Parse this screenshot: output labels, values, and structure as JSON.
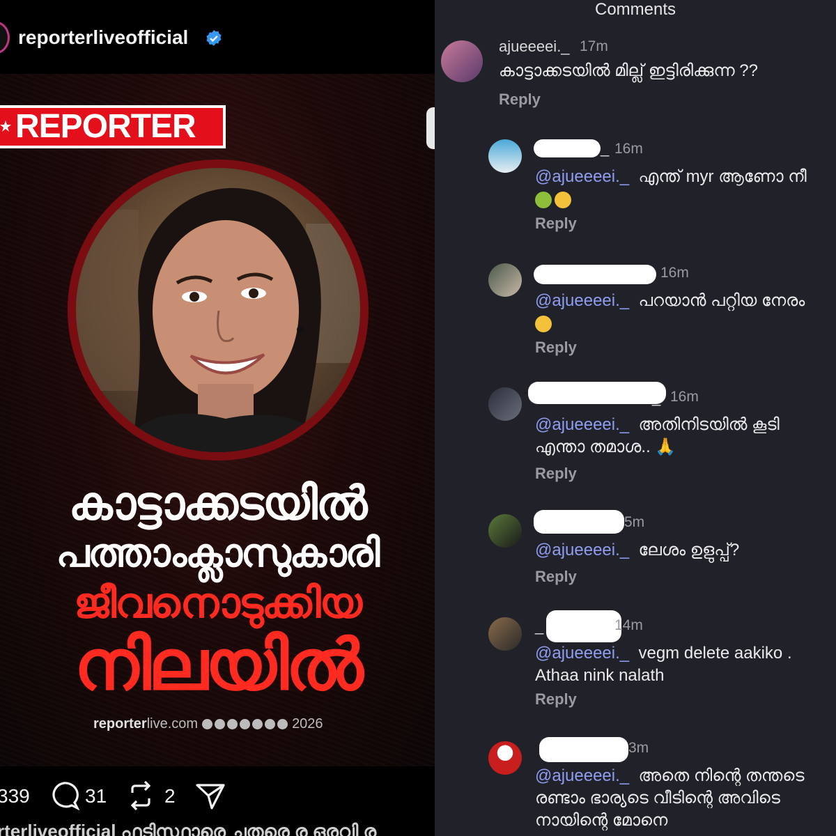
{
  "post": {
    "username": "reporterliveofficial",
    "verified": true,
    "logo_text": "REPORTER",
    "headline": [
      "കാട്ടാക്കടയിൽ",
      "പത്താംക്ലാസുകാരി",
      "ജീവനൊടുക്കിയ",
      "നിലയിൽ"
    ],
    "footer_site_bold": "reporter",
    "footer_site_rest": "live.com",
    "footer_year": "2026",
    "likes": "339",
    "comments_count": "31",
    "reposts": "2",
    "caption_partial": "rterliveofficial  ഫടിസ്ഥാരെ ചതരെ ര  ഒരവി ര"
  },
  "comments": {
    "title": "Comments",
    "reply_label": "Reply",
    "items": [
      {
        "user": "ajueeeei._",
        "time": "17m",
        "mention": "",
        "text": "കാട്ടാക്കടയിൽ  മില്ല് ഇട്ടിരിക്കുന്ന ??",
        "emoji": []
      },
      {
        "user": "_",
        "time": "16m",
        "mention": "@ajueeeei._",
        "text": "എന്ത് myr ആണോ നീ",
        "emoji": [
          "nauseated",
          "unamused"
        ]
      },
      {
        "user": "",
        "time": "16m",
        "mention": "@ajueeeei._",
        "text": "പറയാൻ പറ്റിയ നേരം",
        "emoji": [
          "smile"
        ]
      },
      {
        "user": "_",
        "time": "16m",
        "mention": "@ajueeeei._",
        "text": "അതിനിടയിൽ കൂടി എന്താ തമാശ.. 🙏",
        "emoji": []
      },
      {
        "user": "",
        "time": "5m",
        "mention": "@ajueeeei._",
        "text": "ലേശം ഉളുപ്പ്?",
        "emoji": []
      },
      {
        "user": "_",
        "time": "14m",
        "mention": "@ajueeeei._",
        "text": "vegm delete aakiko . Athaa nink nalath",
        "emoji": []
      },
      {
        "user": "",
        "time": "3m",
        "mention": "@ajueeeei._",
        "text": "അതെ നിന്റെ തന്തടെ രണ്ടാം ഭാര്യടെ വീടിന്റെ അവിടെ നായിന്റെ മോനെ",
        "emoji": []
      }
    ]
  },
  "colors": {
    "accent_red": "#e3101b",
    "mention_blue": "#8f9df0",
    "panel_bg": "#212229"
  }
}
